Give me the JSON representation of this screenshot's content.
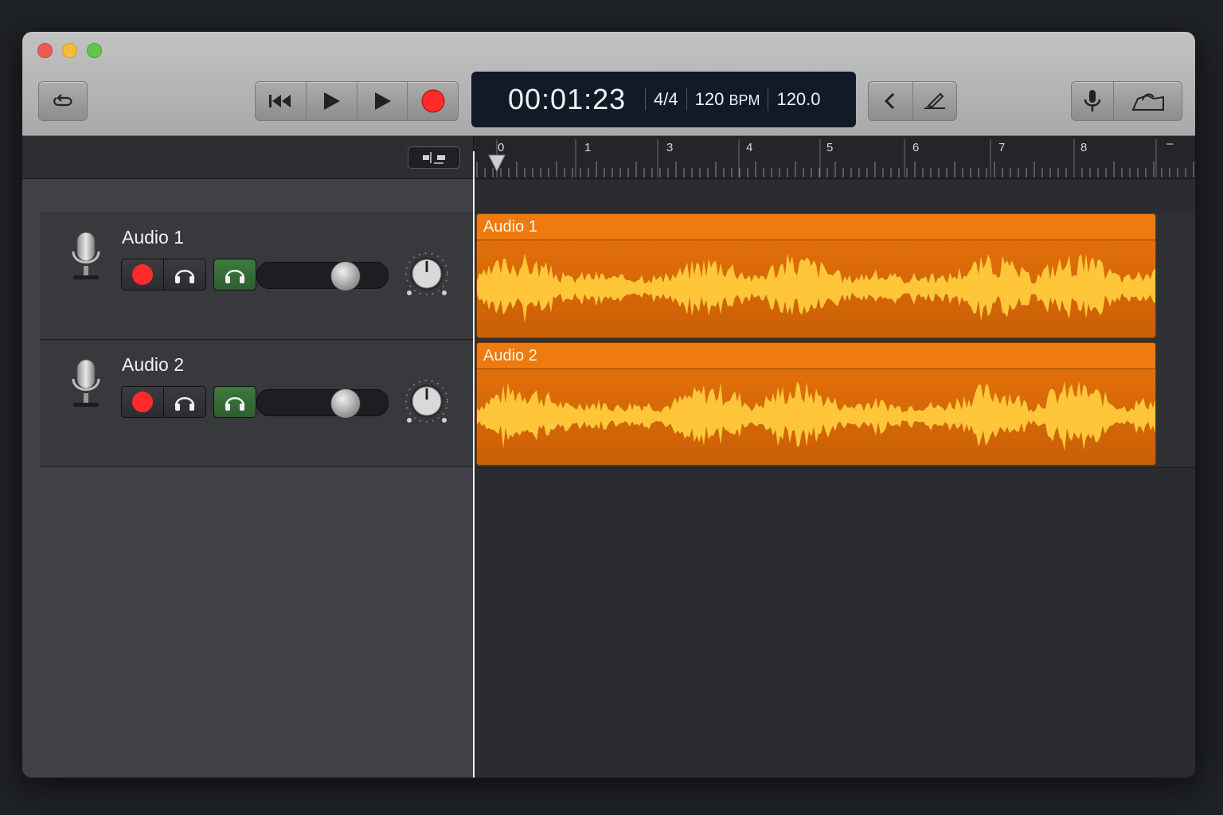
{
  "window": {
    "traffic_lights": [
      "close",
      "minimize",
      "zoom"
    ]
  },
  "toolbar": {
    "cycle_icon": "cycle-icon",
    "transport": [
      "rewind-icon",
      "play-icon",
      "play-icon",
      "record-icon"
    ],
    "lcd": {
      "time": "00:01:23",
      "signature": "4/4",
      "tempo_value": "120",
      "tempo_unit": "BPM",
      "tempo_decimal": "120.0"
    },
    "right_left_group": [
      "chevron-left-icon",
      "pencil-icon"
    ],
    "right_group": [
      "microphone-icon",
      "hand-icon"
    ]
  },
  "ruler": {
    "labels": [
      "0",
      "1",
      "3",
      "4",
      "5",
      "6",
      "7",
      "8"
    ],
    "end_marker": "–"
  },
  "tracks": [
    {
      "name": "Audio 1",
      "region_name": "Audio 1",
      "volume": 0.7,
      "pan": 0
    },
    {
      "name": "Audio 2",
      "region_name": "Audio 2",
      "volume": 0.7,
      "pan": 0
    }
  ],
  "colors": {
    "region": "#e8740b",
    "record": "#ff2b2b",
    "monitor": "#3d7a3d",
    "waveform": "#ffc63a"
  }
}
